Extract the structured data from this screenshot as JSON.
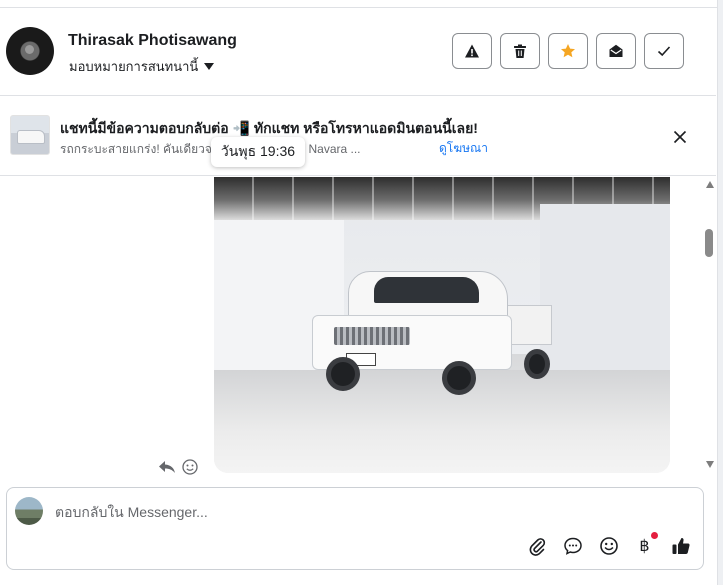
{
  "header": {
    "contact_name": "Thirasak Photisawang",
    "assign_label": "มอบหมายการสนทนานี้",
    "actions": [
      {
        "name": "report-spam",
        "icon": "warning-icon"
      },
      {
        "name": "delete",
        "icon": "trash-icon"
      },
      {
        "name": "star",
        "icon": "star-icon",
        "color": "#f5a623"
      },
      {
        "name": "mark-unread",
        "icon": "envelope-open-icon"
      },
      {
        "name": "mark-done",
        "icon": "check-icon"
      }
    ]
  },
  "ad_banner": {
    "title": "แชทนี้มีข้อความตอบกลับต่อ 📲 ทักแชท หรือโทรหาแอดมินตอนนี้เลย!",
    "subtitle": "รถกระบะสายแกร่ง! คันเดียวจบ ...0 บาท Nissan Navara ...",
    "link_label": "ดูโฆษณา"
  },
  "tooltip": {
    "text": "วันพุธ 19:36"
  },
  "message": {
    "image_alt": "white Nissan Navara pickup truck in showroom"
  },
  "composer": {
    "placeholder": "ตอบกลับใน Messenger...",
    "tools": [
      "paperclip-icon",
      "chat-bubble-icon",
      "emoji-icon",
      "baht-icon",
      "thumbs-up-icon"
    ],
    "baht_symbol": "฿"
  },
  "colors": {
    "accent_link": "#1877f2",
    "star": "#f5a623",
    "notification_dot": "#e41e3f"
  }
}
